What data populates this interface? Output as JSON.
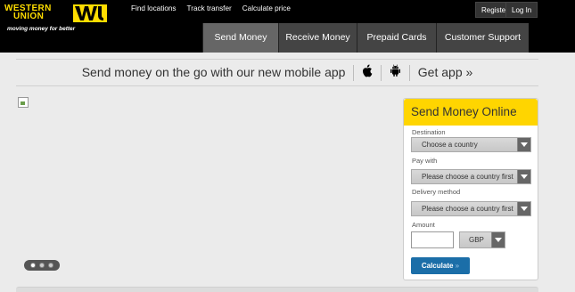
{
  "brand": {
    "logo_line1": "WESTERN",
    "logo_line2": "UNION",
    "tagline": "moving money for better",
    "accent": "#ffdd00"
  },
  "top_links": [
    {
      "label": "Find locations"
    },
    {
      "label": "Track transfer"
    },
    {
      "label": "Calculate price"
    }
  ],
  "account": {
    "register": "Register",
    "login": "Log In"
  },
  "main_nav": [
    {
      "label": "Send Money"
    },
    {
      "label": "Receive Money"
    },
    {
      "label": "Prepaid Cards"
    },
    {
      "label": "Customer Support"
    }
  ],
  "promo": {
    "text": "Send money on the go with our new mobile app",
    "cta": "Get app »",
    "icons": [
      "apple-icon",
      "android-icon"
    ]
  },
  "slider": {
    "dots": 3,
    "active": 0
  },
  "widget": {
    "title": "Send Money Online",
    "destination_label": "Destination",
    "destination_value": "Choose a country",
    "pay_with_label": "Pay with",
    "pay_with_value": "Please choose a country first",
    "delivery_label": "Delivery method",
    "delivery_value": "Please choose a country first",
    "amount_label": "Amount",
    "amount_value": "",
    "currency": "GBP",
    "calculate": "Calculate",
    "calculate_suffix": "»",
    "title_color": "#ffd500",
    "button_color": "#1b6ea8"
  }
}
